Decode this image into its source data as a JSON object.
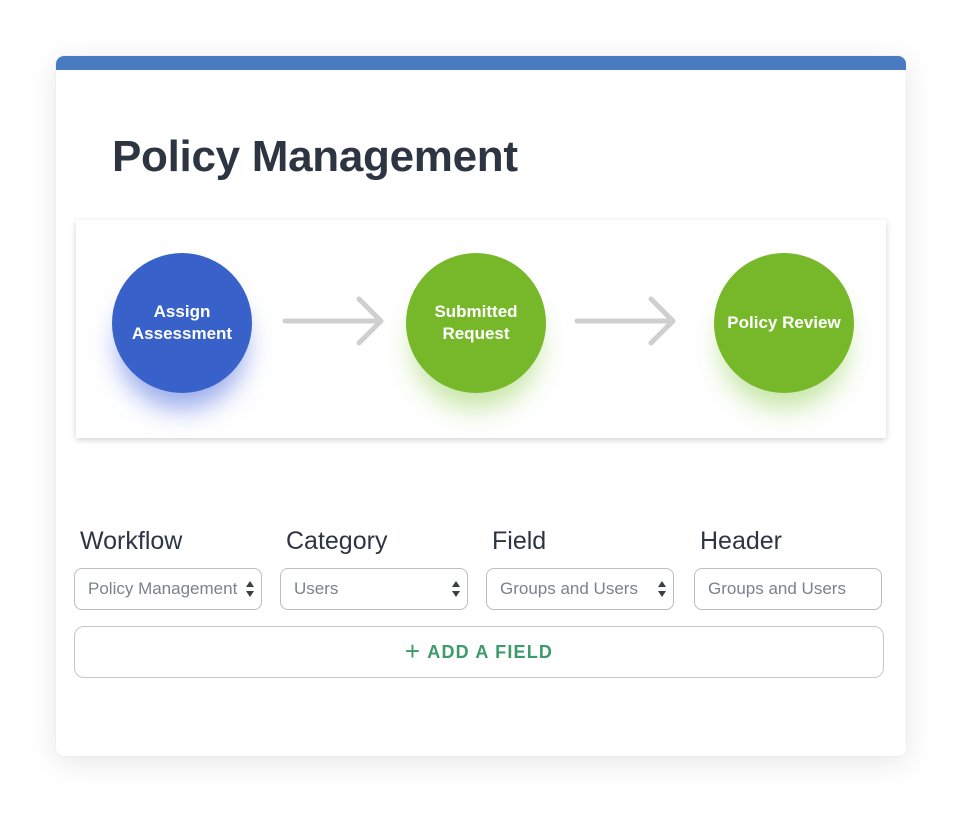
{
  "page": {
    "title": "Policy Management"
  },
  "colors": {
    "top_bar": "#4a7ac2",
    "step_blue": "#3862c9",
    "step_green": "#76b82a",
    "add_field_text": "#3d9a6a",
    "arrow": "#cfcfcf"
  },
  "workflow": {
    "steps": [
      {
        "label": "Assign Assessment",
        "color": "blue"
      },
      {
        "label": "Submitted Request",
        "color": "green"
      },
      {
        "label": "Policy Review",
        "color": "green"
      }
    ],
    "connector_icon": "right-arrow-icon"
  },
  "form": {
    "fields": [
      {
        "label": "Workflow",
        "value": "Policy Management",
        "type": "select"
      },
      {
        "label": "Category",
        "value": "Users",
        "type": "select"
      },
      {
        "label": "Field",
        "value": "Groups and Users",
        "type": "select"
      },
      {
        "label": "Header",
        "value": "Groups and Users",
        "type": "text"
      }
    ],
    "add_field_label": "ADD A FIELD",
    "add_field_icon": "plus-icon"
  }
}
